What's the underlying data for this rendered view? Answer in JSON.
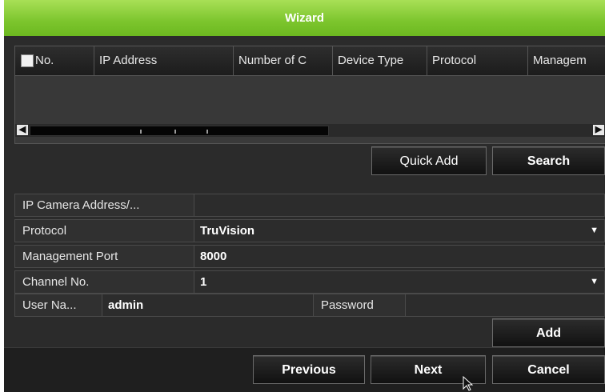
{
  "window": {
    "title": "Wizard"
  },
  "device_table": {
    "columns": [
      "No.",
      "IP Address",
      "Number of C",
      "Device Type",
      "Protocol",
      "Managem"
    ],
    "rows": []
  },
  "buttons": {
    "quick_add": "Quick Add",
    "search": "Search",
    "add": "Add",
    "previous": "Previous",
    "next": "Next",
    "cancel": "Cancel"
  },
  "form": {
    "ip_address_label": "IP Camera Address/...",
    "ip_address_value": "",
    "protocol_label": "Protocol",
    "protocol_value": "TruVision",
    "mgmt_port_label": "Management Port",
    "mgmt_port_value": "8000",
    "channel_label": "Channel No.",
    "channel_value": "1",
    "username_label": "User Na...",
    "username_value": "admin",
    "password_label": "Password",
    "password_value": ""
  },
  "colors": {
    "title_bar": "#7cc52d",
    "background": "#2b2b2b"
  }
}
